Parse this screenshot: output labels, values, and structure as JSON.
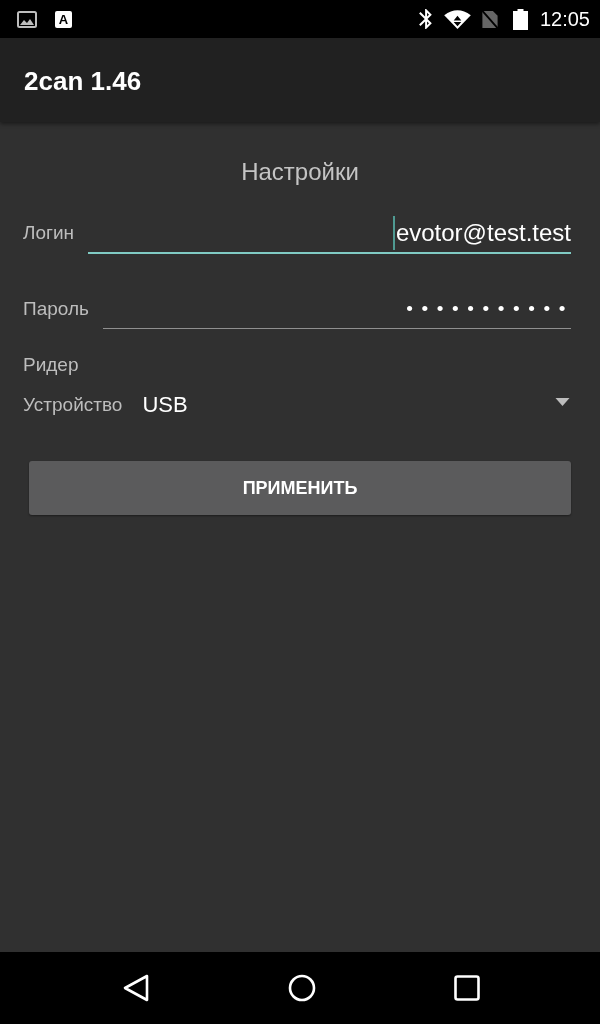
{
  "status_bar": {
    "notification_letter": "A",
    "time": "12:05"
  },
  "app_bar": {
    "title": "2can 1.46"
  },
  "settings": {
    "heading": "Настройки",
    "fields": [
      {
        "kind": "text",
        "label": "Логин",
        "value": "evotor@test.test",
        "focused": true
      },
      {
        "kind": "password",
        "label": "Пароль",
        "value": "•••••••••••",
        "focused": false
      }
    ],
    "section": "Ридер",
    "device": {
      "label": "Устройство",
      "value": "USB"
    },
    "apply_button": "ПРИМЕНИТЬ"
  }
}
